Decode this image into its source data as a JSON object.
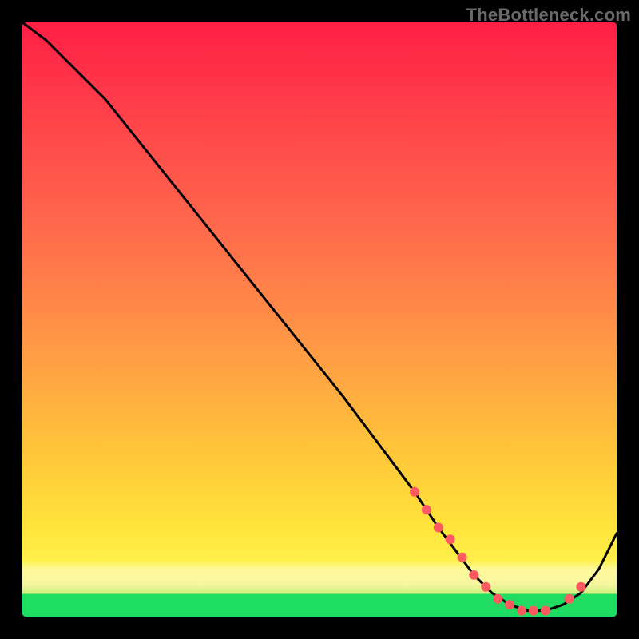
{
  "watermark": "TheBottleneck.com",
  "chart_data": {
    "type": "line",
    "title": "",
    "xlabel": "",
    "ylabel": "",
    "xlim": [
      0,
      100
    ],
    "ylim": [
      0,
      100
    ],
    "grid": false,
    "legend": false,
    "background_gradient": {
      "top_color": "#ff1e44",
      "mid_color": "#ffe43a",
      "band_color": "#fef89a",
      "bottom_color": "#1fdc63"
    },
    "series": [
      {
        "name": "bottleneck-curve",
        "color": "#000000",
        "x": [
          0,
          4,
          8,
          14,
          22,
          30,
          38,
          46,
          54,
          60,
          66,
          70,
          73,
          76,
          79,
          82,
          85,
          88,
          91,
          94,
          97,
          100
        ],
        "values": [
          100,
          97,
          93,
          87,
          77,
          67,
          57,
          47,
          37,
          29,
          21,
          15,
          11,
          7,
          4,
          2,
          1,
          1,
          2,
          4,
          8,
          14
        ]
      }
    ],
    "markers": {
      "name": "highlight-dots",
      "color": "#ff5a5f",
      "radius_px": 6,
      "x": [
        66,
        68,
        70,
        72,
        74,
        76,
        78,
        80,
        82,
        84,
        86,
        88,
        92,
        94
      ],
      "values": [
        21,
        18,
        15,
        13,
        10,
        7,
        5,
        3,
        2,
        1,
        1,
        1,
        3,
        5
      ]
    }
  }
}
